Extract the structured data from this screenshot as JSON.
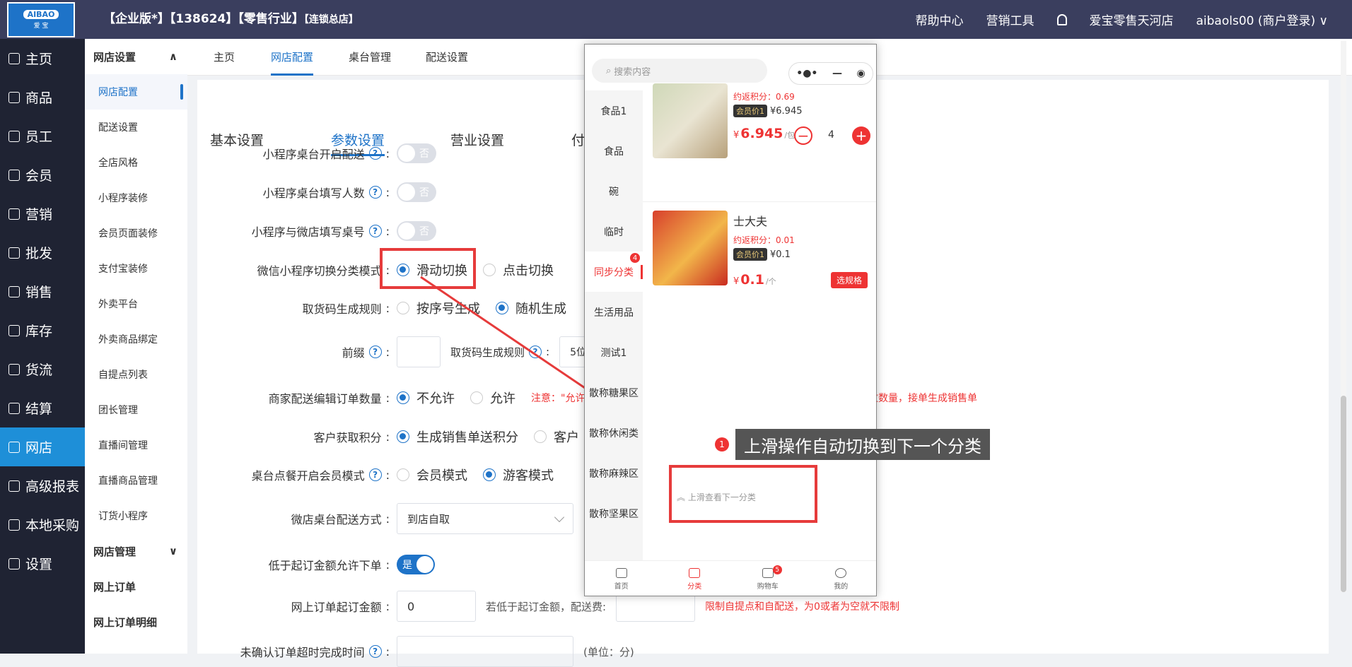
{
  "header": {
    "title": "【企业版*】【138624】【零售行业】",
    "title_small": "【连锁总店】",
    "logo_top": "AIBAO",
    "logo_bottom": "爱 宝",
    "nav": [
      "帮助中心",
      "营销工具"
    ],
    "store": "爱宝零售天河店",
    "user": "aibaols00 (商户登录)"
  },
  "sidebar": [
    {
      "label": "主页",
      "icon": "home-icon"
    },
    {
      "label": "商品",
      "icon": "goods-icon"
    },
    {
      "label": "员工",
      "icon": "staff-icon"
    },
    {
      "label": "会员",
      "icon": "member-icon"
    },
    {
      "label": "营销",
      "icon": "marketing-icon"
    },
    {
      "label": "批发",
      "icon": "wholesale-icon"
    },
    {
      "label": "销售",
      "icon": "sales-icon"
    },
    {
      "label": "库存",
      "icon": "stock-icon"
    },
    {
      "label": "货流",
      "icon": "flow-icon"
    },
    {
      "label": "结算",
      "icon": "settle-icon"
    },
    {
      "label": "网店",
      "icon": "shop-icon"
    },
    {
      "label": "高级报表",
      "icon": "report-icon"
    },
    {
      "label": "本地采购",
      "icon": "purchase-icon"
    },
    {
      "label": "设置",
      "icon": "settings-icon"
    }
  ],
  "submenu": {
    "group1": "网店设置",
    "items": [
      "网店配置",
      "配送设置",
      "全店风格",
      "小程序装修",
      "会员页面装修",
      "支付宝装修",
      "外卖平台",
      "外卖商品绑定",
      "自提点列表",
      "团长管理",
      "直播间管理",
      "直播商品管理",
      "订货小程序"
    ],
    "group2": "网店管理",
    "items2": [
      "网上订单",
      "网上订单明细"
    ]
  },
  "tabs": [
    "主页",
    "网店配置",
    "桌台管理",
    "配送设置"
  ],
  "tabs2": [
    "基本设置",
    "参数设置",
    "营业设置",
    "付"
  ],
  "form": {
    "r1": {
      "label": "小程序桌台开启配送",
      "value": "否"
    },
    "r2": {
      "label": "小程序桌台填写人数",
      "value": "否"
    },
    "r3": {
      "label": "小程序与微店填写桌号",
      "value": "否"
    },
    "r4": {
      "label": "微信小程序切换分类模式",
      "opt1": "滑动切换",
      "opt2": "点击切换"
    },
    "r5": {
      "label": "取货码生成规则",
      "opt1": "按序号生成",
      "opt2": "随机生成"
    },
    "r6": {
      "label": "前缀",
      "label2": "取货码生成规则",
      "partial": "5位"
    },
    "r7": {
      "label": "商家配送编辑订单数量",
      "opt1": "不允许",
      "opt2": "允许",
      "warn1": "注意：\"允许",
      "warn2": "修改数量，接单生成销售单"
    },
    "r8": {
      "label": "客户获取积分",
      "opt1": "生成销售单送积分",
      "opt2": "客户"
    },
    "r9": {
      "label": "桌台点餐开启会员模式",
      "opt1": "会员模式",
      "opt2": "游客模式"
    },
    "r10": {
      "label": "微店桌台配送方式",
      "value": "到店自取"
    },
    "r11": {
      "label": "低于起订金额允许下单",
      "value": "是"
    },
    "r12": {
      "label": "网上订单起订金额",
      "value": "0",
      "note": "若低于起订金额，配送费:",
      "warn": "限制自提点和自配送，为0或者为空就不限制"
    },
    "r13": {
      "label": "未确认订单超时完成时间",
      "note": "(单位：分)"
    }
  },
  "phone": {
    "search": "搜索内容",
    "categories": [
      "食品1",
      "食品",
      "碗",
      "临时",
      "同步分类",
      "生活用品",
      "测试1",
      "散称糖果区",
      "散称休闲类",
      "散称麻辣区",
      "散称坚果区"
    ],
    "badge": "4",
    "p1": {
      "points": "约返积分：0.69",
      "member_tag": "会员价1",
      "member_price": "¥6.945",
      "yen": "¥",
      "price": "6.945",
      "unit": "/包",
      "qty": "4"
    },
    "p2": {
      "name": "士大夫",
      "points": "约返积分：0.01",
      "member_tag": "会员价1",
      "member_price": "¥0.1",
      "yen": "¥",
      "price": "0.1",
      "unit": "/个",
      "spec": "选规格"
    },
    "swipe": "上滑查看下一分类",
    "bottom": [
      "首页",
      "分类",
      "购物车",
      "我的"
    ],
    "cart_badge": "5"
  },
  "tooltip": {
    "num": "1",
    "text": "上滑操作自动切换到下一个分类"
  },
  "colors": {
    "accent": "#1e73c8",
    "danger": "#e33",
    "sidebar": "#1f2333",
    "topbar": "#3a3e5e"
  }
}
